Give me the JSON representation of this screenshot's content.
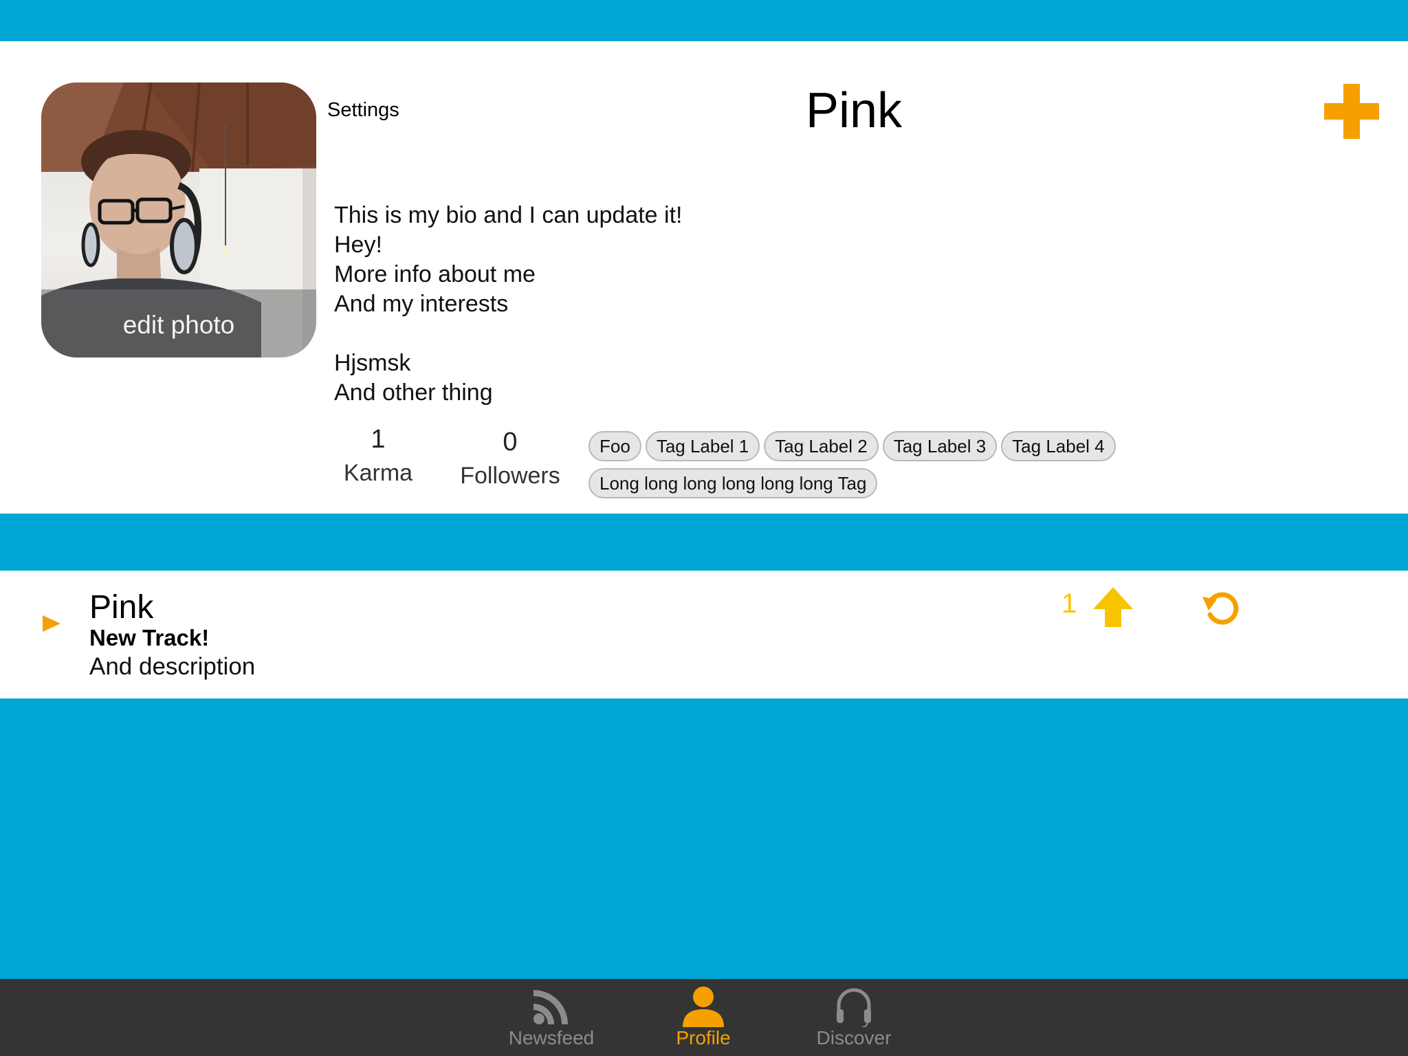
{
  "colors": {
    "brand_blue": "#00a6d3",
    "accent_orange": "#f5a000",
    "upvote_yellow": "#f7c400",
    "tab_bar": "#343434",
    "tab_inactive": "#8c8c8c"
  },
  "profile": {
    "edit_photo_label": "edit photo",
    "settings_label": "Settings",
    "name": "Pink",
    "add_icon": "plus-icon",
    "bio": "This is my bio and I can update it!\nHey!\nMore info about me\nAnd my interests\n\nHjsmsk\nAnd other thing",
    "stats": {
      "karma_value": "1",
      "karma_label": "Karma",
      "followers_value": "0",
      "followers_label": "Followers"
    },
    "tags": [
      "Foo",
      "Tag Label 1",
      "Tag Label 2",
      "Tag Label 3",
      "Tag Label 4",
      "Long long long long long long Tag"
    ]
  },
  "track": {
    "play_icon": "play-icon",
    "artist": "Pink",
    "title": "New Track!",
    "description": "And description",
    "vote_count": "1",
    "upvote_icon": "arrow-up-icon",
    "repost_icon": "repost-icon"
  },
  "tab_bar": {
    "tabs": [
      {
        "label": "Newsfeed",
        "icon": "rss-icon",
        "active": false
      },
      {
        "label": "Profile",
        "icon": "person-icon",
        "active": true
      },
      {
        "label": "Discover",
        "icon": "headphones-icon",
        "active": false
      }
    ]
  }
}
